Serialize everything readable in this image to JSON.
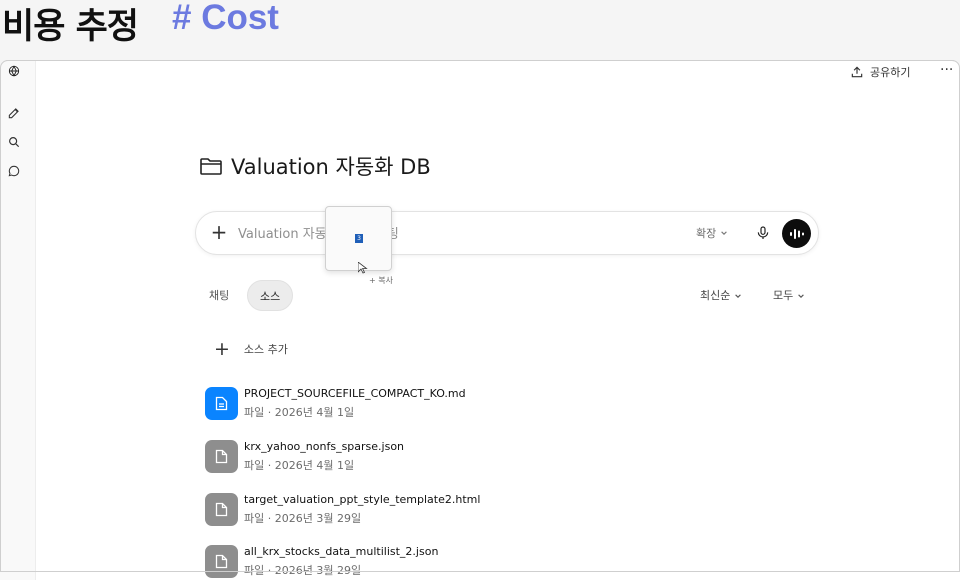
{
  "banner": {
    "title": "비용 추정",
    "tag": "# Cost"
  },
  "topbar": {
    "share_label": "공유하기",
    "more_label": "···"
  },
  "project": {
    "title": "Valuation 자동화 DB"
  },
  "composer": {
    "placeholder": "Valuation 자동화 내 새 채팅",
    "expand_label": "확장"
  },
  "drag": {
    "badge": "3",
    "copy_label": "+ 복사"
  },
  "tabs": {
    "chat": "채팅",
    "source": "소스",
    "sort_order": "최신순",
    "sort_filter": "모두"
  },
  "sources": {
    "add_label": "소스 추가",
    "files": [
      {
        "name": "PROJECT_SOURCEFILE_COMPACT_KO.md",
        "meta": "파일 · 2026년 4월 1일",
        "icon": "document-icon",
        "color": "#0a84ff"
      },
      {
        "name": "krx_yahoo_nonfs_sparse.json",
        "meta": "파일 · 2026년 4월 1일",
        "icon": "file-icon",
        "color": "#8e8e8e"
      },
      {
        "name": "target_valuation_ppt_style_template2.html",
        "meta": "파일 · 2026년 3월 29일",
        "icon": "file-icon",
        "color": "#8e8e8e"
      },
      {
        "name": "all_krx_stocks_data_multilist_2.json",
        "meta": "파일 · 2026년 3월 29일",
        "icon": "file-icon",
        "color": "#8e8e8e"
      }
    ]
  }
}
